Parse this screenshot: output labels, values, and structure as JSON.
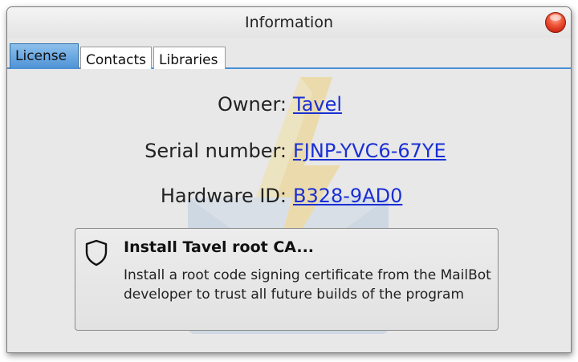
{
  "window": {
    "title": "Information"
  },
  "tabs": [
    {
      "label": "License",
      "active": true
    },
    {
      "label": "Contacts",
      "active": false
    },
    {
      "label": "Libraries",
      "active": false
    }
  ],
  "license": {
    "owner_label": "Owner:",
    "owner_value": "Tavel",
    "serial_label": "Serial number:",
    "serial_value": "FJNP-YVC6-67YE",
    "hwid_label": "Hardware ID:",
    "hwid_value": "B328-9AD0"
  },
  "install_ca": {
    "title": "Install Tavel root CA...",
    "description": "Install a root code signing certificate from the MailBot developer to trust all future builds of the program",
    "icon": "shield-icon"
  },
  "colors": {
    "accent": "#4a8fd6",
    "link": "#1a2fd4",
    "close": "#e8442a"
  }
}
